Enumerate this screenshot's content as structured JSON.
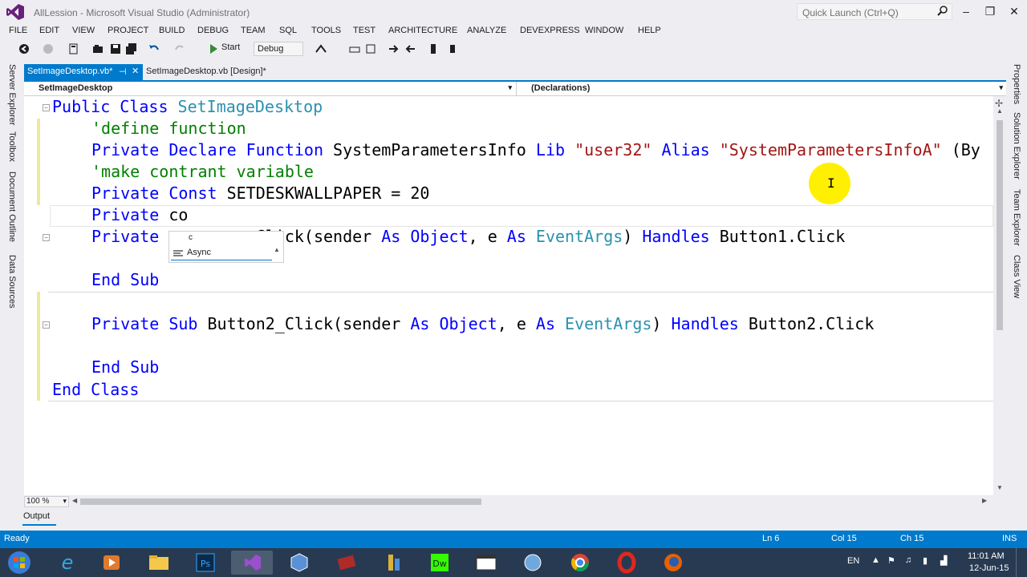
{
  "window": {
    "title": "AllLession - Microsoft Visual Studio (Administrator)",
    "quick_launch_placeholder": "Quick Launch (Ctrl+Q)",
    "accent": "#007acc"
  },
  "menu": [
    "FILE",
    "EDIT",
    "VIEW",
    "PROJECT",
    "BUILD",
    "DEBUG",
    "TEAM",
    "SQL",
    "TOOLS",
    "TEST",
    "ARCHITECTURE",
    "ANALYZE",
    "DEVEXPRESS",
    "WINDOW",
    "HELP"
  ],
  "toolbar": {
    "start_label": "Start",
    "config_label": "Debug"
  },
  "left_rail": [
    "Server Explorer",
    "Toolbox",
    "Document Outline",
    "Data Sources"
  ],
  "right_rail": [
    "Properties",
    "Solution Explorer",
    "Team Explorer",
    "Class View"
  ],
  "tabs": [
    {
      "label": "SetImageDesktop.vb*",
      "active": true
    },
    {
      "label": "SetImageDesktop.vb [Design]*",
      "active": false
    }
  ],
  "nav": {
    "left": "SetImageDesktop",
    "right": "(Declarations)"
  },
  "code": {
    "l1_kw": "Public Class ",
    "l1_ty": "SetImageDesktop",
    "l2_cm": "'define function",
    "l3_kw1": "Private Declare Function ",
    "l3_name": "SystemParametersInfo ",
    "l3_kw2": "Lib ",
    "l3_str1": "\"user32\"",
    "l3_kw3": " Alias ",
    "l3_str2": "\"SystemParametersInfoA\"",
    "l3_tail": " (By",
    "l4_cm": "'make contrant variable",
    "l5_kw": "Private Const ",
    "l5_rest": "SETDESKWALLPAPER = 20",
    "l6_kw": "Private ",
    "l6_rest": "co",
    "l7_kw": "Private ",
    "l7_a": "         Click(sender ",
    "l7_as1": "As ",
    "l7_obj": "Object",
    "l7_b": ", e ",
    "l7_as2": "As ",
    "l7_ty": "EventArgs",
    "l7_c": ") ",
    "l7_handles": "Handles ",
    "l7_d": "Button1.Click",
    "l8_kw": "End Sub",
    "l9_kw": "Private Sub ",
    "l9_a": "Button2_Click(sender ",
    "l9_as1": "As ",
    "l9_obj": "Object",
    "l9_b": ", e ",
    "l9_as2": "As ",
    "l9_ty": "EventArgs",
    "l9_c": ") ",
    "l9_handles": "Handles ",
    "l9_d": "Button2.Click",
    "l10_kw": "End Sub",
    "l11_kw": "End Class"
  },
  "completion": {
    "typed": "c",
    "item": "Async"
  },
  "zoom": "100 %",
  "output_tab": "Output",
  "status": {
    "ready": "Ready",
    "ln": "Ln 6",
    "col": "Col 15",
    "ch": "Ch 15",
    "ins": "INS"
  },
  "tray": {
    "lang": "EN",
    "time": "11:01 AM",
    "date": "12-Jun-15"
  }
}
